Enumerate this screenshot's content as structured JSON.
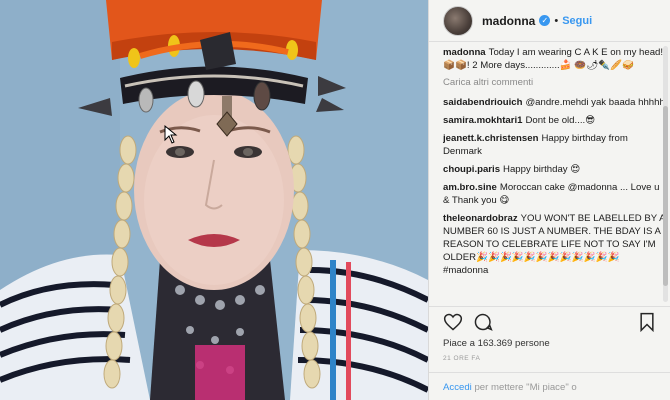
{
  "header": {
    "username": "madonna",
    "verified_badge": "✓",
    "separator": "•",
    "follow_label": "Segui"
  },
  "caption": {
    "username": "madonna",
    "text": "Today I am wearing C A K E on my head! 📦📦! 2 More days.............🍰 🍩🌶✒️🥖🥪"
  },
  "load_more_label": "Carica altri commenti",
  "comments": [
    {
      "user": "saidabendriouich",
      "text": "@andre.mehdi yak baada hhhhh"
    },
    {
      "user": "samira.mokhtari1",
      "text": "Dont be old....😎"
    },
    {
      "user": "jeanett.k.christensen",
      "text": "Happy birthday from Denmark"
    },
    {
      "user": "choupi.paris",
      "text": "Happy birthday 😍"
    },
    {
      "user": "am.bro.sine",
      "text": "Moroccan cake @madonna ... Love u & Thank you 😋"
    },
    {
      "user": "theleonardobraz",
      "text": "YOU WON'T BE LABELLED BY A NUMBER 60 IS JUST A NUMBER. THE BDAY IS A REASON TO CELEBRATE LIFE NOT TO SAY I'M OLDER🎉🎉🎉🎉🎉🎉🎉🎉🎉🎉🎉🎉 #madonna"
    }
  ],
  "likes_text": "Piace a 163.369 persone",
  "timestamp": "21 ORE FA",
  "login": {
    "link_label": "Accedi",
    "text": " per mettere \"Mi piace\" o"
  },
  "icons": {
    "like": "heart-icon",
    "comment": "comment-bubble-icon",
    "save": "bookmark-icon",
    "verified": "verified-badge-icon"
  },
  "colors": {
    "accent": "#3897f0",
    "panel_bg": "#f4f4f2",
    "hat": "#e2561b",
    "lips": "#b5384a"
  }
}
